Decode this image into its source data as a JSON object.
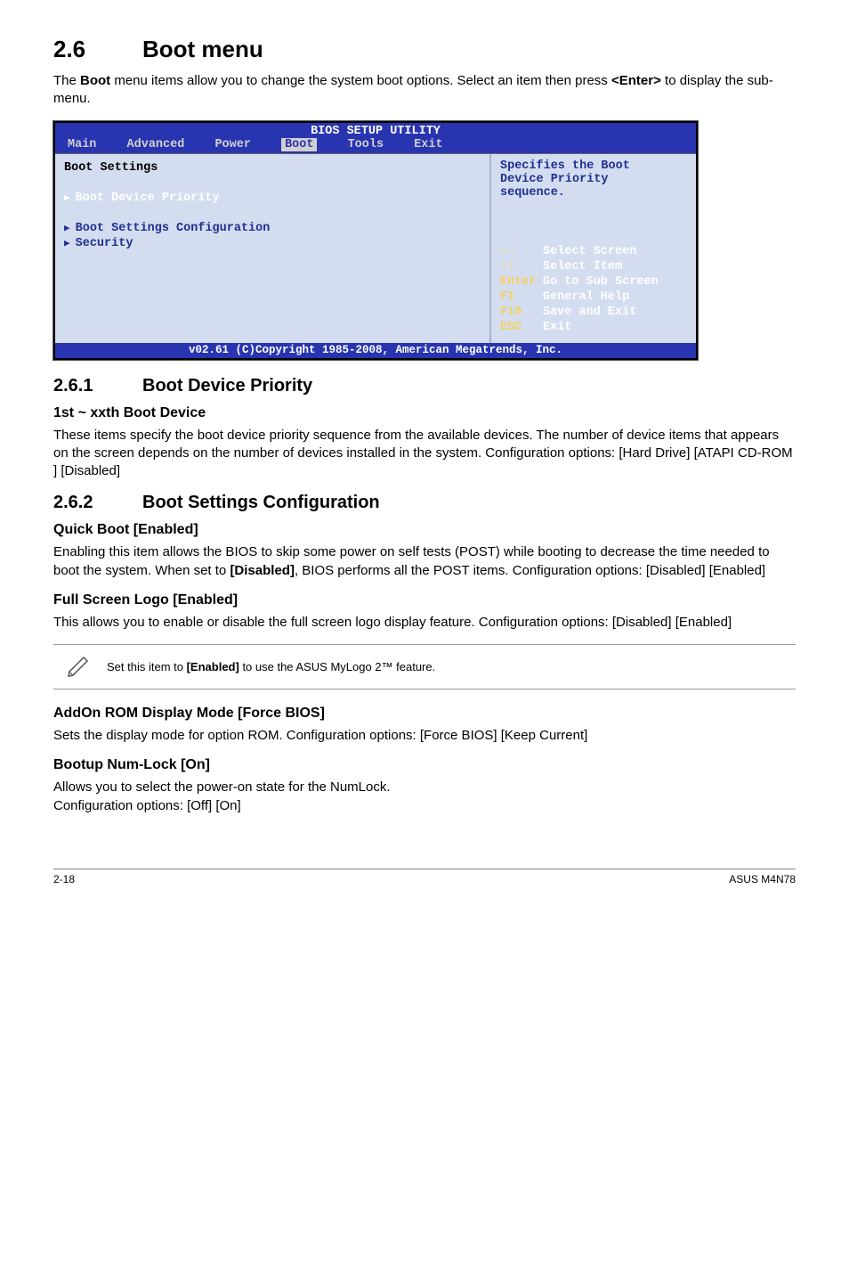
{
  "heading": {
    "num": "2.6",
    "title": "Boot menu"
  },
  "intro": {
    "pre": "The ",
    "bold1": "Boot",
    "mid": " menu items allow you to change the system boot options. Select an item then press ",
    "bold2": "<Enter>",
    "post": " to display the sub-menu."
  },
  "bios": {
    "title": "BIOS SETUP UTILITY",
    "tabs": [
      "Main",
      "Advanced",
      "Power",
      "Boot",
      "Tools",
      "Exit"
    ],
    "selected_tab_index": 3,
    "left": {
      "header": "Boot Settings",
      "item_hl": "Boot Device Priority",
      "item2": "Boot Settings Configuration",
      "item3": "Security"
    },
    "right": {
      "desc1": "Specifies the Boot",
      "desc2": "Device Priority",
      "desc3": "sequence.",
      "keys": [
        {
          "k": "←→",
          "v": "Select Screen"
        },
        {
          "k": "↓↑",
          "v": "Select Item"
        },
        {
          "k": "Enter",
          "v": "Go to Sub Screen"
        },
        {
          "k": "F1",
          "v": "General Help"
        },
        {
          "k": "F10",
          "v": "Save and Exit"
        },
        {
          "k": "ESC",
          "v": "Exit"
        }
      ]
    },
    "footer": "v02.61 (C)Copyright 1985-2008, American Megatrends, Inc."
  },
  "s261": {
    "num": "2.6.1",
    "title": "Boot Device Priority",
    "h": "1st ~ xxth Boot Device",
    "p": "These items specify the boot device priority sequence from the available devices. The number of device items that appears on the screen depends on the number of devices installed in the system. Configuration options: [Hard Drive] [ATAPI CD-ROM ] [Disabled]"
  },
  "s262": {
    "num": "2.6.2",
    "title": "Boot Settings Configuration",
    "qb_h": "Quick Boot [Enabled]",
    "qb_p_pre": "Enabling this item allows the BIOS to skip some power on self tests (POST) while booting to decrease the time needed to boot the system. When set to ",
    "qb_p_bold": "[Disabled]",
    "qb_p_post": ", BIOS performs all the POST items. Configuration options: [Disabled] [Enabled]",
    "fs_h": "Full Screen Logo [Enabled]",
    "fs_p": "This allows you to enable or disable the full screen logo display feature. Configuration options: [Disabled] [Enabled]",
    "note_pre": "Set this item to ",
    "note_bold": "[Enabled]",
    "note_post": " to use the ASUS MyLogo 2™ feature.",
    "ar_h": "AddOn ROM Display Mode [Force BIOS]",
    "ar_p": "Sets the display mode for option ROM. Configuration options: [Force BIOS] [Keep Current]",
    "bn_h": "Bootup Num-Lock [On]",
    "bn_p1": "Allows you to select the power-on state for the NumLock.",
    "bn_p2": "Configuration options: [Off] [On]"
  },
  "footer": {
    "left": "2-18",
    "right": "ASUS M4N78"
  }
}
